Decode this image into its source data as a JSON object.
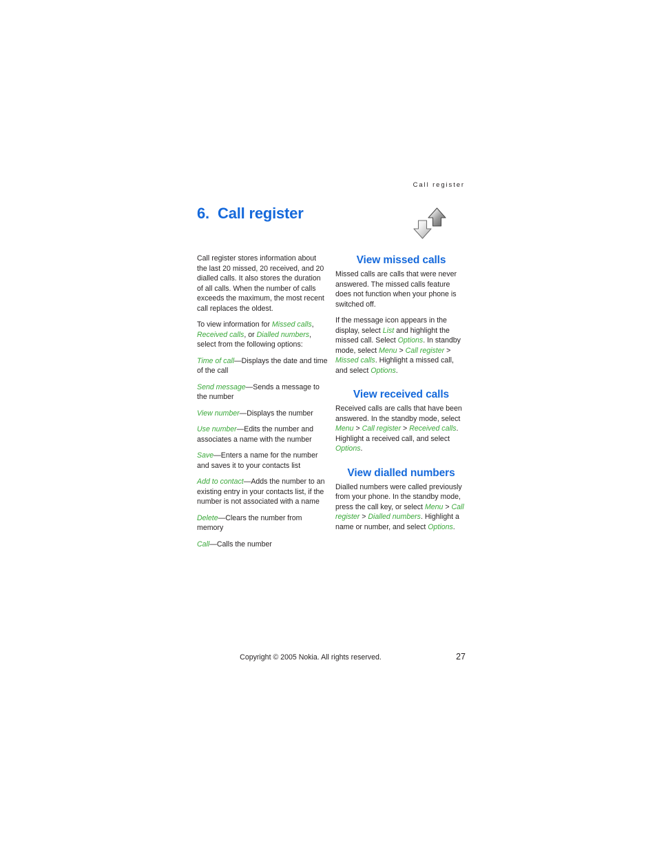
{
  "page": {
    "running_header": "Call register",
    "chapter_number": "6.",
    "chapter_title": "Call register",
    "icon_name": "up-down-arrows-icon",
    "page_number": "27",
    "copyright": "Copyright © 2005 Nokia. All rights reserved."
  },
  "colors": {
    "heading_blue": "#1569db",
    "term_green": "#3aa83a",
    "body_text": "#231f20",
    "background": "#ffffff"
  },
  "left_column": {
    "intro": "Call register stores information about the last 20 missed, 20 received, and 20 dialled calls. It also stores the duration of all calls. When the number of calls exceeds the maximum, the most recent call replaces the oldest.",
    "view_info_lead": "To view information for ",
    "view_info_term1": "Missed calls",
    "view_info_sep1": ", ",
    "view_info_term2": "Received calls",
    "view_info_sep2": ", or ",
    "view_info_term3": "Dialled numbers",
    "view_info_tail": ", select from the following options:",
    "options": [
      {
        "term": "Time of call",
        "desc": "—Displays the date and time of the call"
      },
      {
        "term": "Send message",
        "desc": "—Sends a message to the number"
      },
      {
        "term": "View number",
        "desc": "—Displays the number"
      },
      {
        "term": "Use number",
        "desc": "—Edits the number and associates a name with the number"
      },
      {
        "term": "Save",
        "desc": "—Enters a name for the number and saves it to your contacts list"
      },
      {
        "term": "Add to contact",
        "desc": "—Adds the number to an existing entry in your contacts list, if the number is not associated with a name"
      },
      {
        "term": "Delete",
        "desc": "—Clears the number from memory"
      },
      {
        "term": "Call",
        "desc": "—Calls the number"
      }
    ]
  },
  "right_column": {
    "missed": {
      "heading": "View missed calls",
      "para1": "Missed calls are calls that were never answered. The missed calls feature does not function when your phone is switched off.",
      "p2_a": "If the message icon appears in the display, select ",
      "p2_t1": "List",
      "p2_b": " and highlight the missed call. Select ",
      "p2_t2": "Options",
      "p2_c": ". In standby mode, select ",
      "p2_t3": "Menu",
      "p2_gt1": " > ",
      "p2_t4": "Call register",
      "p2_gt2": " > ",
      "p2_t5": "Missed calls",
      "p2_d": ". Highlight a missed call, and select ",
      "p2_t6": "Options",
      "p2_e": "."
    },
    "received": {
      "heading": "View received calls",
      "p_a": "Received calls are calls that have been answered. In the standby mode, select ",
      "p_t1": "Menu",
      "p_gt1": " > ",
      "p_t2": "Call register",
      "p_gt2": " > ",
      "p_t3": "Received calls",
      "p_b": ". Highlight a received call, and select ",
      "p_t4": "Options",
      "p_c": "."
    },
    "dialled": {
      "heading": "View dialled numbers",
      "p_a": "Dialled numbers were called previously from your phone. In the standby mode, press the call key, or select ",
      "p_t1": "Menu",
      "p_gt1": " > ",
      "p_t2": "Call register",
      "p_gt2": " > ",
      "p_t3": "Dialled numbers",
      "p_b": ". Highlight a name or number, and select ",
      "p_t4": "Options",
      "p_c": "."
    }
  }
}
